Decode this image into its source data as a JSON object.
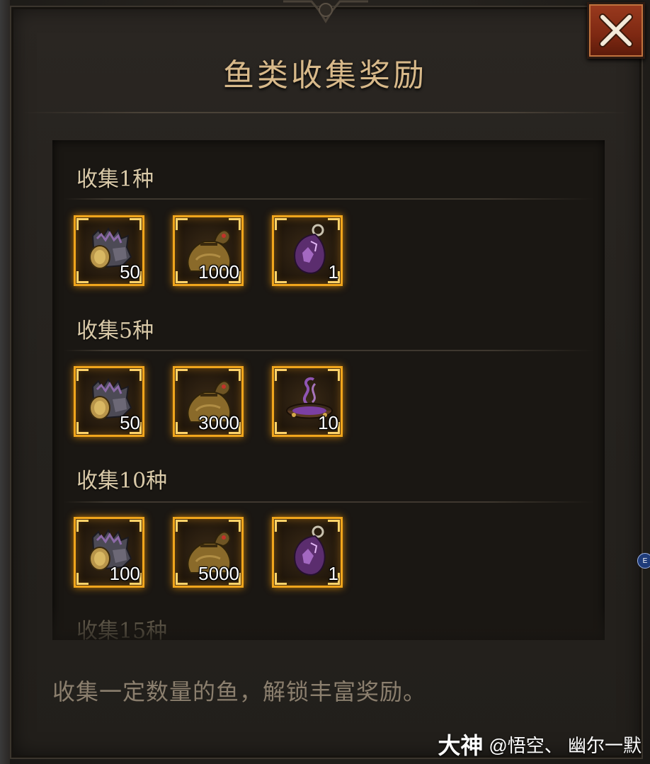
{
  "title": "鱼类收集奖励",
  "close_icon": "close-x-icon",
  "tiers": [
    {
      "label": "收集1种",
      "rewards": [
        {
          "icon": "armor-helmet-icon",
          "qty": "50"
        },
        {
          "icon": "gold-pouch-icon",
          "qty": "1000"
        },
        {
          "icon": "purple-gem-pendant-icon",
          "qty": "1"
        }
      ]
    },
    {
      "label": "收集5种",
      "rewards": [
        {
          "icon": "armor-helmet-icon",
          "qty": "50"
        },
        {
          "icon": "gold-pouch-icon",
          "qty": "3000"
        },
        {
          "icon": "purple-incense-bowl-icon",
          "qty": "10"
        }
      ]
    },
    {
      "label": "收集10种",
      "rewards": [
        {
          "icon": "armor-helmet-icon",
          "qty": "100"
        },
        {
          "icon": "gold-pouch-icon",
          "qty": "5000"
        },
        {
          "icon": "purple-gem-pendant-icon",
          "qty": "1"
        }
      ]
    },
    {
      "label": "收集15种",
      "rewards": []
    }
  ],
  "footer": "收集一定数量的鱼，解锁丰富奖励。",
  "watermark": {
    "logo": "大神",
    "user": "@悟空、 幽尔一默"
  },
  "side_badge": "E",
  "colors": {
    "title": "#d8b98a",
    "slot_border": "#f0a51c",
    "close_button": "#8a2e16",
    "footer_text": "#8b7f6e"
  }
}
